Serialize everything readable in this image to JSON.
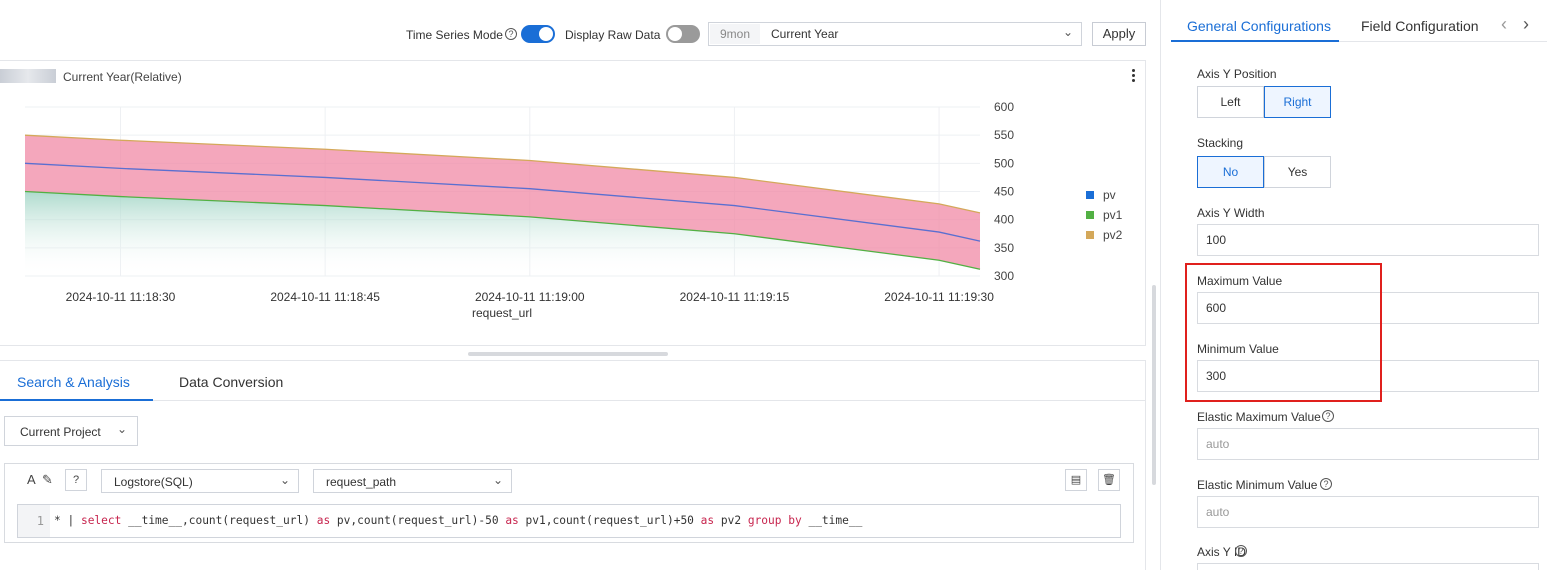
{
  "toolbar": {
    "time_series_mode_label": "Time Series Mode",
    "time_series_mode_on": true,
    "display_raw_data_label": "Display Raw Data",
    "display_raw_data_on": false,
    "time_range_badge": "9mon",
    "time_range_value": "Current Year",
    "apply_label": "Apply"
  },
  "chart_panel": {
    "title": "Current Year(Relative)"
  },
  "chart_data": {
    "type": "area",
    "x": [
      "2024-10-11 11:18:23",
      "2024-10-11 11:18:30",
      "2024-10-11 11:18:45",
      "2024-10-11 11:19:00",
      "2024-10-11 11:19:15",
      "2024-10-11 11:19:30",
      "2024-10-11 11:19:33"
    ],
    "x_tick_labels": [
      "2024-10-11 11:18:30",
      "2024-10-11 11:18:45",
      "2024-10-11 11:19:00",
      "2024-10-11 11:19:15",
      "2024-10-11 11:19:30"
    ],
    "xlabel": "request_url",
    "ylabel": "",
    "ylim": [
      300,
      600
    ],
    "y_ticks": [
      600,
      550,
      500,
      450,
      400,
      350,
      300
    ],
    "y_axis_position": "right",
    "legend_position": "right",
    "series": [
      {
        "name": "pv",
        "color": "#1a6ed6",
        "values": [
          500,
          491,
          475,
          455,
          425,
          378,
          362
        ]
      },
      {
        "name": "pv1",
        "color": "#52b043",
        "values": [
          450,
          441,
          425,
          405,
          375,
          328,
          312
        ]
      },
      {
        "name": "pv2",
        "color": "#d4a85a",
        "values": [
          550,
          541,
          525,
          505,
          475,
          428,
          412
        ]
      }
    ]
  },
  "query": {
    "tabs": [
      "Search & Analysis",
      "Data Conversion"
    ],
    "project_label": "Current Project",
    "logstore_type": "Logstore(SQL)",
    "logstore_name": "request_path",
    "line_number": "1",
    "code_prefix": "* | ",
    "code_parts": [
      {
        "t": "select",
        "kw": true
      },
      {
        "t": " __time__,count(request_url) ",
        "kw": false
      },
      {
        "t": "as",
        "kw": true
      },
      {
        "t": " pv,count(request_url)-50 ",
        "kw": false
      },
      {
        "t": "as",
        "kw": true
      },
      {
        "t": " pv1,count(request_url)+50 ",
        "kw": false
      },
      {
        "t": "as",
        "kw": true
      },
      {
        "t": " pv2 ",
        "kw": false
      },
      {
        "t": "group by",
        "kw": true
      },
      {
        "t": " __time__",
        "kw": false
      }
    ]
  },
  "config": {
    "tabs": [
      "General Configurations",
      "Field Configuration"
    ],
    "axis_y_position_label": "Axis Y Position",
    "axis_y_position_options": [
      "Left",
      "Right"
    ],
    "axis_y_position_selected": "Right",
    "stacking_label": "Stacking",
    "stacking_options": [
      "No",
      "Yes"
    ],
    "stacking_selected": "No",
    "axis_y_width_label": "Axis Y Width",
    "axis_y_width_value": "100",
    "max_label": "Maximum Value",
    "max_value": "600",
    "min_label": "Minimum Value",
    "min_value": "300",
    "elastic_max_label": "Elastic Maximum Value",
    "elastic_max_placeholder": "auto",
    "elastic_min_label": "Elastic Minimum Value",
    "elastic_min_placeholder": "auto",
    "axis_y_id_label": "Axis Y ID"
  }
}
